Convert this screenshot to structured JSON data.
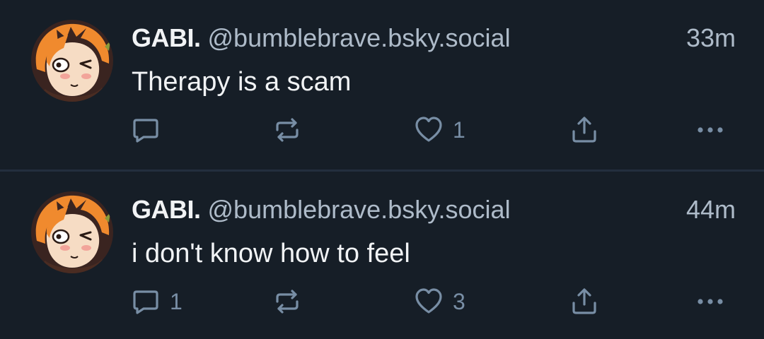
{
  "posts": [
    {
      "author_name": "GABI.",
      "handle": "@bumblebrave.bsky.social",
      "time": "33m",
      "text": "Therapy is a scam",
      "reply_count": "",
      "like_count": "1",
      "icons": {
        "reply": "reply-icon",
        "repost": "repost-icon",
        "like": "heart-icon",
        "share": "share-icon",
        "more": "more-icon"
      }
    },
    {
      "author_name": "GABI.",
      "handle": "@bumblebrave.bsky.social",
      "time": "44m",
      "text": "i don't know how to feel",
      "reply_count": "1",
      "like_count": "3",
      "icons": {
        "reply": "reply-icon",
        "repost": "repost-icon",
        "like": "heart-icon",
        "share": "share-icon",
        "more": "more-icon"
      }
    }
  ],
  "colors": {
    "background": "#161e27",
    "divider": "#232e3e",
    "text_primary": "#f1f3f5",
    "text_secondary": "#aebbc9",
    "icon": "#788ea5"
  }
}
